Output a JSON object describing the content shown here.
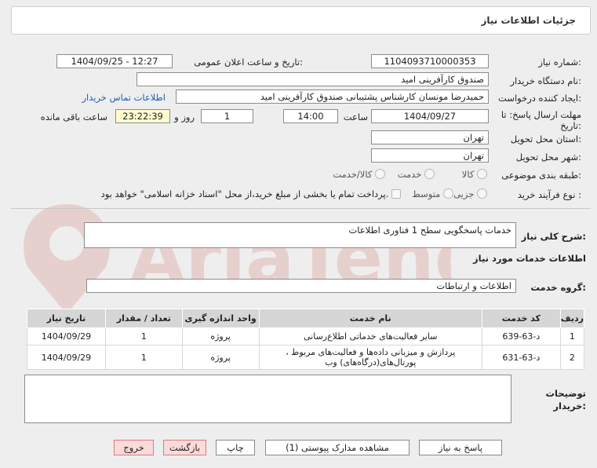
{
  "header": {
    "title": "جزئیات اطلاعات نیاز"
  },
  "form": {
    "need_number_label": "شماره نیاز:",
    "need_number": "1104093710000353",
    "announce_label": "تاریخ و ساعت اعلان عمومی:",
    "announce_value": "1404/09/25 - 12:27",
    "buyer_org_label": "نام دستگاه خریدار:",
    "buyer_org": "صندوق کارآفرینی امید",
    "creator_label": "ایجاد کننده درخواست:",
    "creator": "حمیدرضا مونسان کارشناس پشتیبانی صندوق کارآفرینی امید",
    "contact_link": "اطلاعات تماس خریدار",
    "deadline_label_1": "مهلت ارسال پاسخ: تا",
    "deadline_label_2": "تاریخ:",
    "deadline_date": "1404/09/27",
    "time_label": "ساعت",
    "deadline_time": "14:00",
    "days_value": "1",
    "days_label": "روز و",
    "remaining_time": "23:22:39",
    "remaining_label": "ساعت باقی مانده",
    "province_label": "استان محل تحویل:",
    "province": "تهران",
    "city_label": "شهر محل تحویل:",
    "city": "تهران",
    "category_label": "طبقه بندی موضوعی:",
    "category_options": [
      "کالا",
      "خدمت",
      "کالا/خدمت"
    ],
    "process_label": "نوع فرآیند خرید :",
    "process_options": [
      "جزیی",
      "متوسط"
    ],
    "payment_text": "پرداخت تمام یا بخشی از مبلغ خرید،از محل \"اسناد خزانه اسلامی\" خواهد بود."
  },
  "summary": {
    "label": "شرح کلی نیاز:",
    "value": "خدمات پاسخگویی سطح 1 فناوری اطلاعات"
  },
  "services_heading": "اطلاعات خدمات مورد نیاز",
  "service_group": {
    "label": "گروه خدمت:",
    "value": "اطلاعات و ارتباطات"
  },
  "table": {
    "headers": [
      "ردیف",
      "کد خدمت",
      "نام خدمت",
      "واحد اندازه گیری",
      "تعداد / مقدار",
      "تاریخ نیاز"
    ],
    "rows": [
      [
        "1",
        "د-63-639",
        "سایر فعالیت‌های خدماتی اطلاع‌رسانی",
        "پروژه",
        "1",
        "1404/09/29"
      ],
      [
        "2",
        "د-63-631",
        "پردازش و میزبانی داده‌ها و فعالیت‌های مربوط ، پورتال‌های(درگاه‌های) وب",
        "پروژه",
        "1",
        "1404/09/29"
      ]
    ]
  },
  "buyer_notes": {
    "label_1": "توضیحات",
    "label_2": "خریدار:"
  },
  "buttons": {
    "reply": "پاسخ به نیاز",
    "attachments": "مشاهده مدارک پیوستی (1)",
    "print": "چاپ",
    "back": "بازگشت",
    "exit": "خروج"
  },
  "colors": {
    "accent_link": "#1a5fb4",
    "danger_button": "#fadada",
    "remaining_bg": "#fffbd0"
  }
}
